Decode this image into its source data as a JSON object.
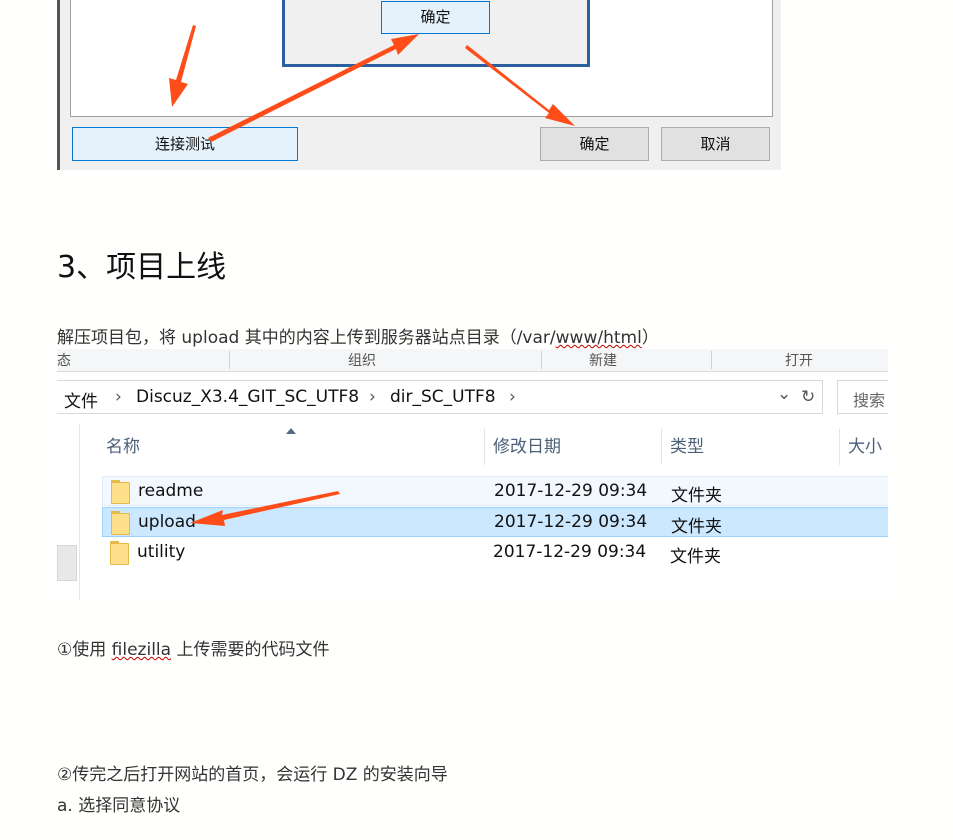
{
  "top_dialog": {
    "inner_ok_label": "确定",
    "connect_test_label": "连接测试",
    "ok_label": "确定",
    "cancel_label": "取消"
  },
  "heading": "3、项目上线",
  "intro": {
    "text_before": "解压项目包，将 upload 其中的内容上传到服务器站点目录（/var/",
    "squiggle_word": "www/html",
    "text_after": "）"
  },
  "explorer": {
    "ribbon": {
      "left_char": "态",
      "organize": "组织",
      "new": "新建",
      "open": "打开"
    },
    "breadcrumb": [
      "文件",
      "Discuz_X3.4_GIT_SC_UTF8",
      "dir_SC_UTF8"
    ],
    "breadcrumb_sep": "›",
    "search_placeholder": "搜索",
    "dropdown_glyph": "⌄",
    "refresh_glyph": "↻",
    "columns": {
      "name": "名称",
      "date": "修改日期",
      "type": "类型",
      "size": "大小"
    },
    "rows": [
      {
        "name": "readme",
        "date": "2017-12-29 09:34",
        "type": "文件夹"
      },
      {
        "name": "upload",
        "date": "2017-12-29 09:34",
        "type": "文件夹"
      },
      {
        "name": "utility",
        "date": "2017-12-29 09:34",
        "type": "文件夹"
      }
    ]
  },
  "step1": {
    "prefix": "①使用 ",
    "squiggle_word": "filezilla",
    "suffix": " 上传需要的代码文件"
  },
  "step2": "②传完之后打开网站的首页，会运行 DZ 的安装向导",
  "step2a": "a. 选择同意协议",
  "colors": {
    "arrow": "#ff4d1a",
    "selected_row": "#cce8ff",
    "dialog_border": "#2b5f9e"
  }
}
